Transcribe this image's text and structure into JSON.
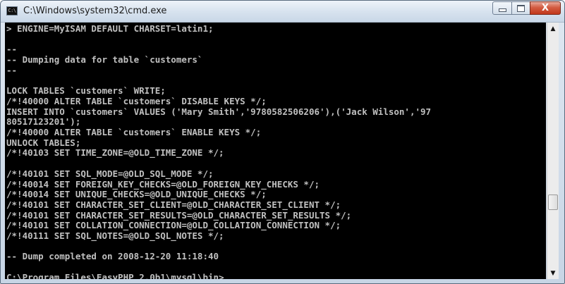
{
  "window": {
    "title": "C:\\Windows\\system32\\cmd.exe",
    "icon": "cmd-console-icon",
    "icon_text": "C:\\",
    "close_glyph": "X"
  },
  "console": {
    "lines": [
      "> ENGINE=MyISAM DEFAULT CHARSET=latin1;",
      "",
      "--",
      "-- Dumping data for table `customers`",
      "--",
      "",
      "LOCK TABLES `customers` WRITE;",
      "/*!40000 ALTER TABLE `customers` DISABLE KEYS */;",
      "INSERT INTO `customers` VALUES ('Mary Smith','9780582506206'),('Jack Wilson','97",
      "80517123201');",
      "/*!40000 ALTER TABLE `customers` ENABLE KEYS */;",
      "UNLOCK TABLES;",
      "/*!40103 SET TIME_ZONE=@OLD_TIME_ZONE */;",
      "",
      "/*!40101 SET SQL_MODE=@OLD_SQL_MODE */;",
      "/*!40014 SET FOREIGN_KEY_CHECKS=@OLD_FOREIGN_KEY_CHECKS */;",
      "/*!40014 SET UNIQUE_CHECKS=@OLD_UNIQUE_CHECKS */;",
      "/*!40101 SET CHARACTER_SET_CLIENT=@OLD_CHARACTER_SET_CLIENT */;",
      "/*!40101 SET CHARACTER_SET_RESULTS=@OLD_CHARACTER_SET_RESULTS */;",
      "/*!40101 SET COLLATION_CONNECTION=@OLD_COLLATION_CONNECTION */;",
      "/*!40111 SET SQL_NOTES=@OLD_SQL_NOTES */;",
      "",
      "-- Dump completed on 2008-12-20 11:18:40",
      ""
    ],
    "prompt": "C:\\Program Files\\EasyPHP 2.0b1\\mysql\\bin>",
    "cursor": "_",
    "text_color": "#c0c0c0",
    "background": "#000000"
  },
  "scrollbar": {
    "up_arrow": "▲",
    "down_arrow": "▼"
  }
}
